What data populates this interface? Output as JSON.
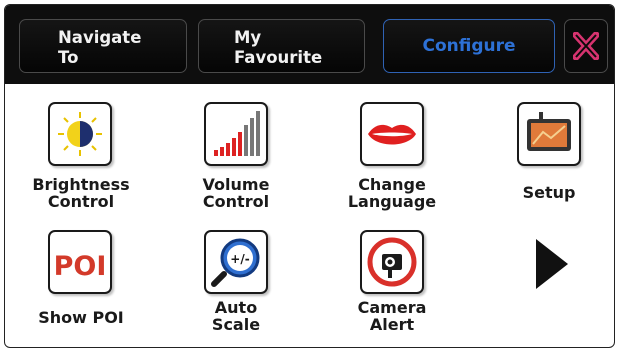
{
  "nav": {
    "navigate_to_line1": "Navigate",
    "navigate_to_line2": "To",
    "favourite_line1": "My",
    "favourite_line2": "Favourite",
    "configure": "Configure"
  },
  "items": {
    "brightness": "Brightness\nControl",
    "volume": "Volume\nControl",
    "language": "Change\nLanguage",
    "setup": "Setup",
    "poi": "Show POI",
    "poi_icon_text": "POI",
    "autoscale": "Auto\nScale",
    "autoscale_icon_text": "+/-",
    "camera": "Camera\nAlert"
  },
  "colors": {
    "topbar": "#0e0e0e",
    "active_tab": "#2d71d6",
    "close_x": "#d6336f",
    "poi_red": "#d33a2a",
    "lips_red": "#e02020",
    "camera_red": "#d9302a",
    "autoscale_blue": "#2f6fd0"
  }
}
